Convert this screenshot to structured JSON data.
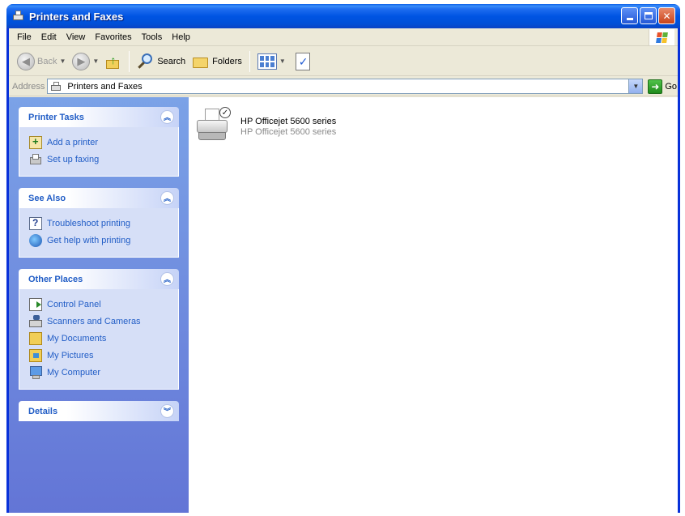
{
  "window": {
    "title": "Printers and Faxes"
  },
  "menu": {
    "items": [
      "File",
      "Edit",
      "View",
      "Favorites",
      "Tools",
      "Help"
    ]
  },
  "toolbar": {
    "back_label": "Back",
    "search_label": "Search",
    "folders_label": "Folders"
  },
  "address": {
    "label": "Address",
    "value": "Printers and Faxes",
    "go_label": "Go"
  },
  "sidebar": {
    "panels": [
      {
        "title": "Printer Tasks",
        "items": [
          {
            "label": "Add a printer",
            "icon": "add-printer-icon"
          },
          {
            "label": "Set up faxing",
            "icon": "fax-icon"
          }
        ]
      },
      {
        "title": "See Also",
        "items": [
          {
            "label": "Troubleshoot printing",
            "icon": "help-icon"
          },
          {
            "label": "Get help with printing",
            "icon": "globe-icon"
          }
        ]
      },
      {
        "title": "Other Places",
        "items": [
          {
            "label": "Control Panel",
            "icon": "control-panel-icon"
          },
          {
            "label": "Scanners and Cameras",
            "icon": "scanner-icon"
          },
          {
            "label": "My Documents",
            "icon": "my-documents-icon"
          },
          {
            "label": "My Pictures",
            "icon": "my-pictures-icon"
          },
          {
            "label": "My Computer",
            "icon": "my-computer-icon"
          }
        ]
      },
      {
        "title": "Details",
        "items": []
      }
    ]
  },
  "printers": [
    {
      "name": "HP Officejet 5600 series",
      "model": "HP Officejet 5600 series",
      "default": true
    }
  ],
  "colors": {
    "titlebar": "#0054e3",
    "sidebar": "#7ba2e7",
    "link": "#215dc6"
  }
}
